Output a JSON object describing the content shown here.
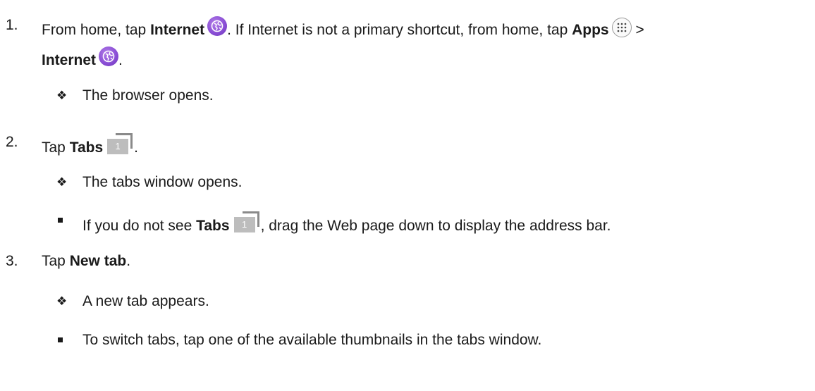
{
  "steps": [
    {
      "number": "1.",
      "pre": "From home, tap ",
      "bold1": "Internet",
      "mid": ". If Internet is not a primary shortcut, from home, tap ",
      "bold2": "Apps",
      "sep": " >",
      "bold3": "Internet",
      "end": ".",
      "result": "The browser opens."
    },
    {
      "number": "2.",
      "pre": "Tap ",
      "bold1": "Tabs",
      "end": ".",
      "result": "The tabs window opens.",
      "note_pre": "If you do not see ",
      "note_bold": "Tabs",
      "note_post": ", drag the Web page down to display the address bar."
    },
    {
      "number": "3.",
      "pre": "Tap ",
      "bold1": "New tab",
      "end": ".",
      "result": "A new tab appears.",
      "note": "To switch tabs, tap one of the available thumbnails in the tabs window."
    }
  ],
  "icons": {
    "tab_count": "1",
    "bullet": "❖"
  }
}
